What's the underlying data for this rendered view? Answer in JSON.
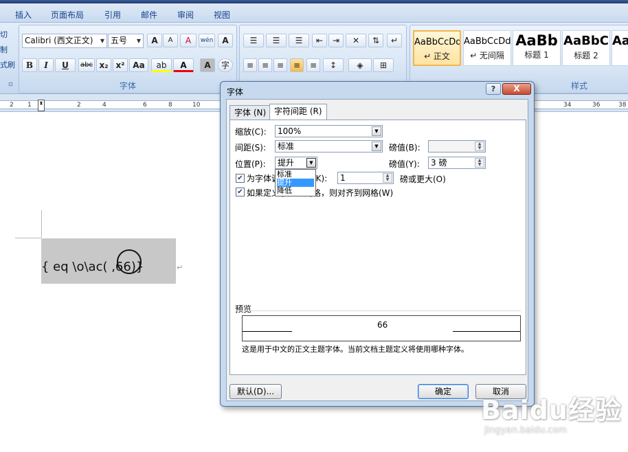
{
  "ribbon": {
    "tabs": [
      "插入",
      "页面布局",
      "引用",
      "邮件",
      "审阅",
      "视图"
    ],
    "left_partial": [
      "切",
      "制",
      "式刷"
    ],
    "font_name": "Calibri (西文正文)",
    "font_size": "五号",
    "font_group_label": "字体",
    "style_group_label": "样式",
    "styles": [
      {
        "sample": "AaBbCcDd",
        "name": "↵ 正文"
      },
      {
        "sample": "AaBbCcDd",
        "name": "↵ 无间隔"
      },
      {
        "sample": "AaBb",
        "name": "标题 1"
      },
      {
        "sample": "AaBbC",
        "name": "标题 2"
      },
      {
        "sample": "Aa",
        "name": ""
      }
    ],
    "buttons": {
      "bold": "B",
      "italic": "I",
      "underline": "U",
      "strike": "abc",
      "subscript": "x₂",
      "superscript": "x²",
      "case": "Aa",
      "grow": "A",
      "shrink": "A",
      "clear": "A",
      "phonetic": "wén",
      "border": "A",
      "highlight": "ab",
      "fontcolor": "A",
      "char_shade": "A",
      "enclose": "字"
    }
  },
  "ruler": {
    "ticks": [
      "2",
      "1",
      "2",
      "4",
      "6",
      "8",
      "10",
      "34",
      "36",
      "38"
    ]
  },
  "document": {
    "field_code": "{  eq \\o\\ac(    ,66)}",
    "para_mark": "↵"
  },
  "dialog": {
    "title": "字体",
    "help": "?",
    "close": "X",
    "tabs": [
      {
        "label": "字体 (N)",
        "active": false
      },
      {
        "label": "字符间距 (R)",
        "active": true
      }
    ],
    "scale_label": "缩放(C):",
    "scale_value": "100%",
    "spacing_label": "间距(S):",
    "spacing_value": "标准",
    "spacing_by_label": "磅值(B):",
    "spacing_by_value": "",
    "position_label": "位置(P):",
    "position_value": "提升",
    "position_by_label": "磅值(Y):",
    "position_by_value": "3 磅",
    "position_options": [
      "标准",
      "提升",
      "降低"
    ],
    "position_selected": "提升",
    "kerning_label": "为字体调整字间距(K):",
    "kerning_value": "1",
    "kerning_suffix": "磅或更大(O)",
    "kerning_checked": true,
    "grid_label": "如果定义了文档网格，则对齐到网格(W)",
    "grid_checked": true,
    "preview_label": "预览",
    "preview_text": "66",
    "preview_note": "这是用于中文的正文主题字体。当前文档主题定义将使用哪种字体。",
    "default_button": "默认(D)...",
    "ok_button": "确定",
    "cancel_button": "取消"
  },
  "watermark": {
    "brand": "Baidu经验",
    "url": "jingyan.baidu.com"
  }
}
